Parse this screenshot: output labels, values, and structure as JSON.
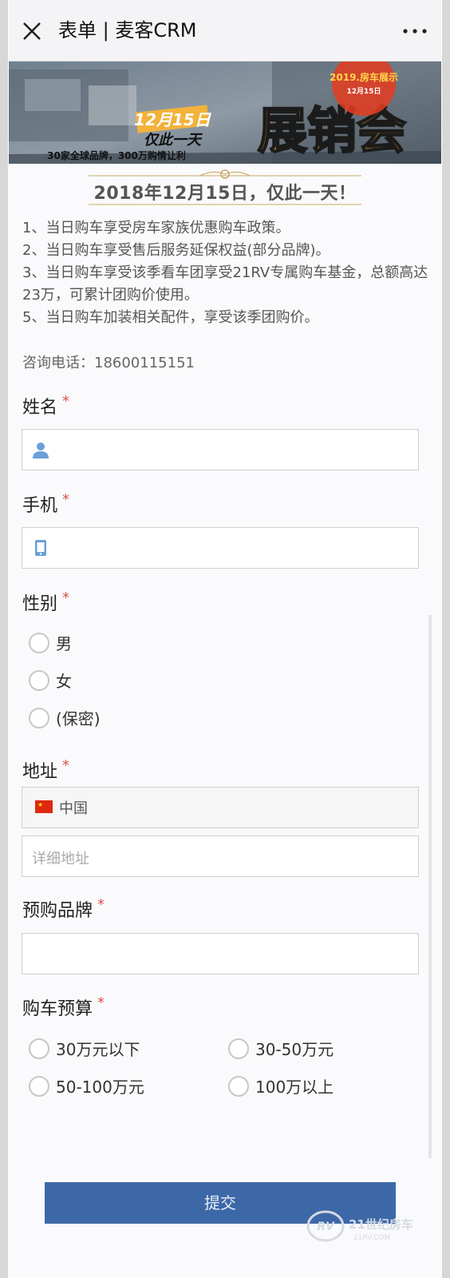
{
  "header": {
    "title": "表单 | 麦客CRM"
  },
  "banner": {
    "date_badge": "12月15日",
    "tagline_1": "仅此一天",
    "tagline_2": "30家全球品牌，300万购情让利",
    "big_title": "展销会",
    "corner_badge": "2019.房车展示",
    "corner_date": "12月15日",
    "heading": "2018年12月15日，仅此一天！"
  },
  "intro": {
    "lines": [
      "1、当日购车享受房车家族优惠购车政策。",
      "2、当日购车享受售后服务延保权益(部分品牌)。",
      "3、当日购车享受该季看车团享受21RV专属购车基金，总额高达23万，可累计团购价使用。",
      "5、当日购车加装相关配件，享受该季团购价。"
    ],
    "contact": "咨询电话：18600115151"
  },
  "form": {
    "name_label": "姓名",
    "phone_label": "手机",
    "gender_label": "性别",
    "gender_options": [
      "男",
      "女",
      "(保密)"
    ],
    "address_label": "地址",
    "country_value": "中国",
    "address_placeholder": "详细地址",
    "brand_label": "预购品牌",
    "budget_label": "购车预算",
    "budget_options": [
      "30万元以下",
      "30-50万元",
      "50-100万元",
      "100万以上"
    ],
    "required_mark": "*",
    "submit_label": "提交"
  },
  "watermark": {
    "text": "21世纪房车",
    "sub": "21RV.COM"
  },
  "colors": {
    "submit_bg": "#3d68a8",
    "required": "#d9534f",
    "icon_blue": "#6aa0d8"
  }
}
